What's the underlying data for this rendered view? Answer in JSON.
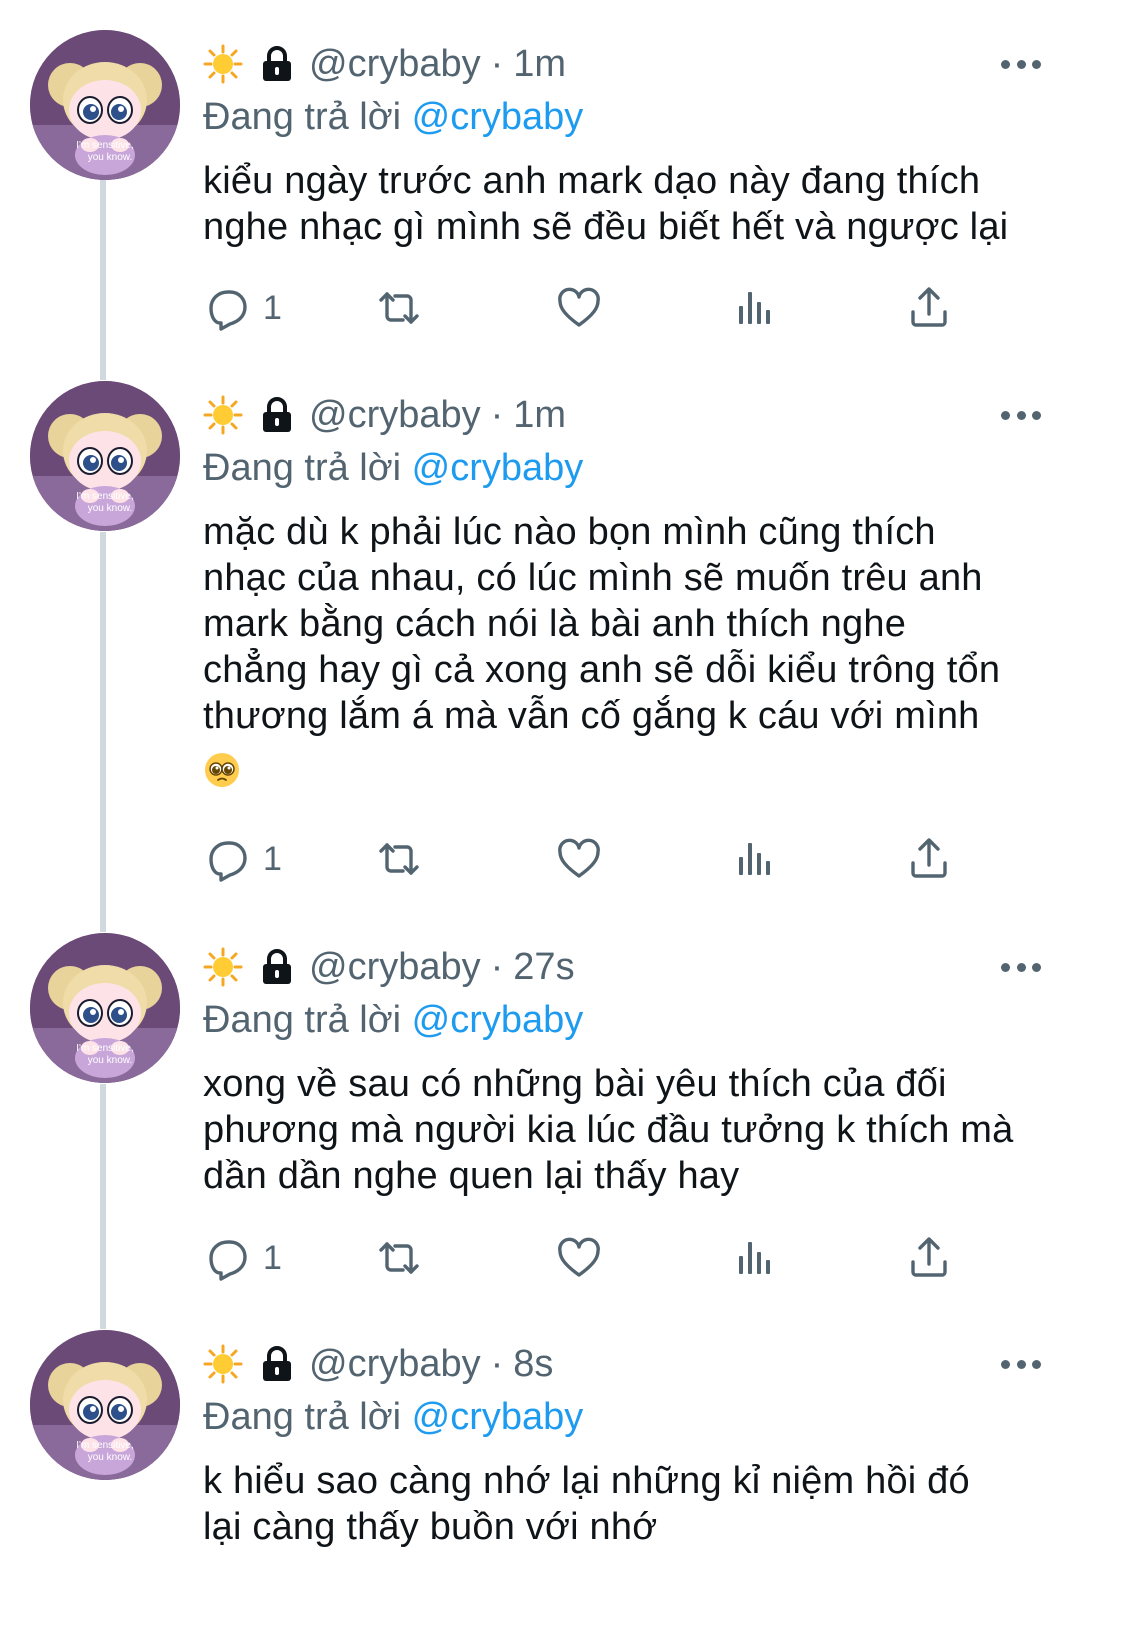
{
  "tweets": [
    {
      "handle": "@crybaby",
      "time": "1m",
      "separator": "·",
      "replying_prefix": "Đang trả lời",
      "replying_to": "@crybaby",
      "text": "kiểu ngày trước anh mark dạo này đang thích\nnghe nhạc gì mình sẽ đều biết hết và ngược lại",
      "reply_count": "1",
      "avatar_caption_1": "I'm sensitive,",
      "avatar_caption_2": "you know."
    },
    {
      "handle": "@crybaby",
      "time": "1m",
      "separator": "·",
      "replying_prefix": "Đang trả lời",
      "replying_to": "@crybaby",
      "text": "mặc dù k phải lúc nào bọn mình cũng thích\nnhạc của nhau, có lúc mình sẽ muốn trêu anh\nmark bằng cách nói là bài anh thích nghe\nchẳng hay gì cả xong anh sẽ dỗi kiểu trông tổn\nthương lắm á mà vẫn cố gắng k cáu với mình",
      "emoji": "pleading-face",
      "reply_count": "1",
      "avatar_caption_1": "I'm sensitive,",
      "avatar_caption_2": "you know."
    },
    {
      "handle": "@crybaby",
      "time": "27s",
      "separator": "·",
      "replying_prefix": "Đang trả lời",
      "replying_to": "@crybaby",
      "text": "xong về sau có những bài yêu thích của đối\nphương mà người kia lúc đầu tưởng k thích mà\ndần dần nghe quen lại thấy hay",
      "reply_count": "1",
      "avatar_caption_1": "I'm sensitive,",
      "avatar_caption_2": "you know."
    },
    {
      "handle": "@crybaby",
      "time": "8s",
      "separator": "·",
      "replying_prefix": "Đang trả lời",
      "replying_to": "@crybaby",
      "text": "k hiểu sao càng nhớ lại những kỉ niệm hồi đó\nlại càng thấy buồn với nhớ",
      "avatar_caption_1": "I'm sensitive,",
      "avatar_caption_2": "you know."
    }
  ],
  "icons": {
    "sun": "sun-emoji-icon",
    "lock": "lock-icon",
    "more": "more-options-icon",
    "reply": "reply-icon",
    "retweet": "retweet-icon",
    "like": "heart-icon",
    "stats": "stats-icon",
    "share": "share-icon"
  },
  "colors": {
    "link": "#1d9bf0",
    "secondary": "#536471",
    "text": "#0f1419",
    "thread_line": "#cfd9de"
  }
}
